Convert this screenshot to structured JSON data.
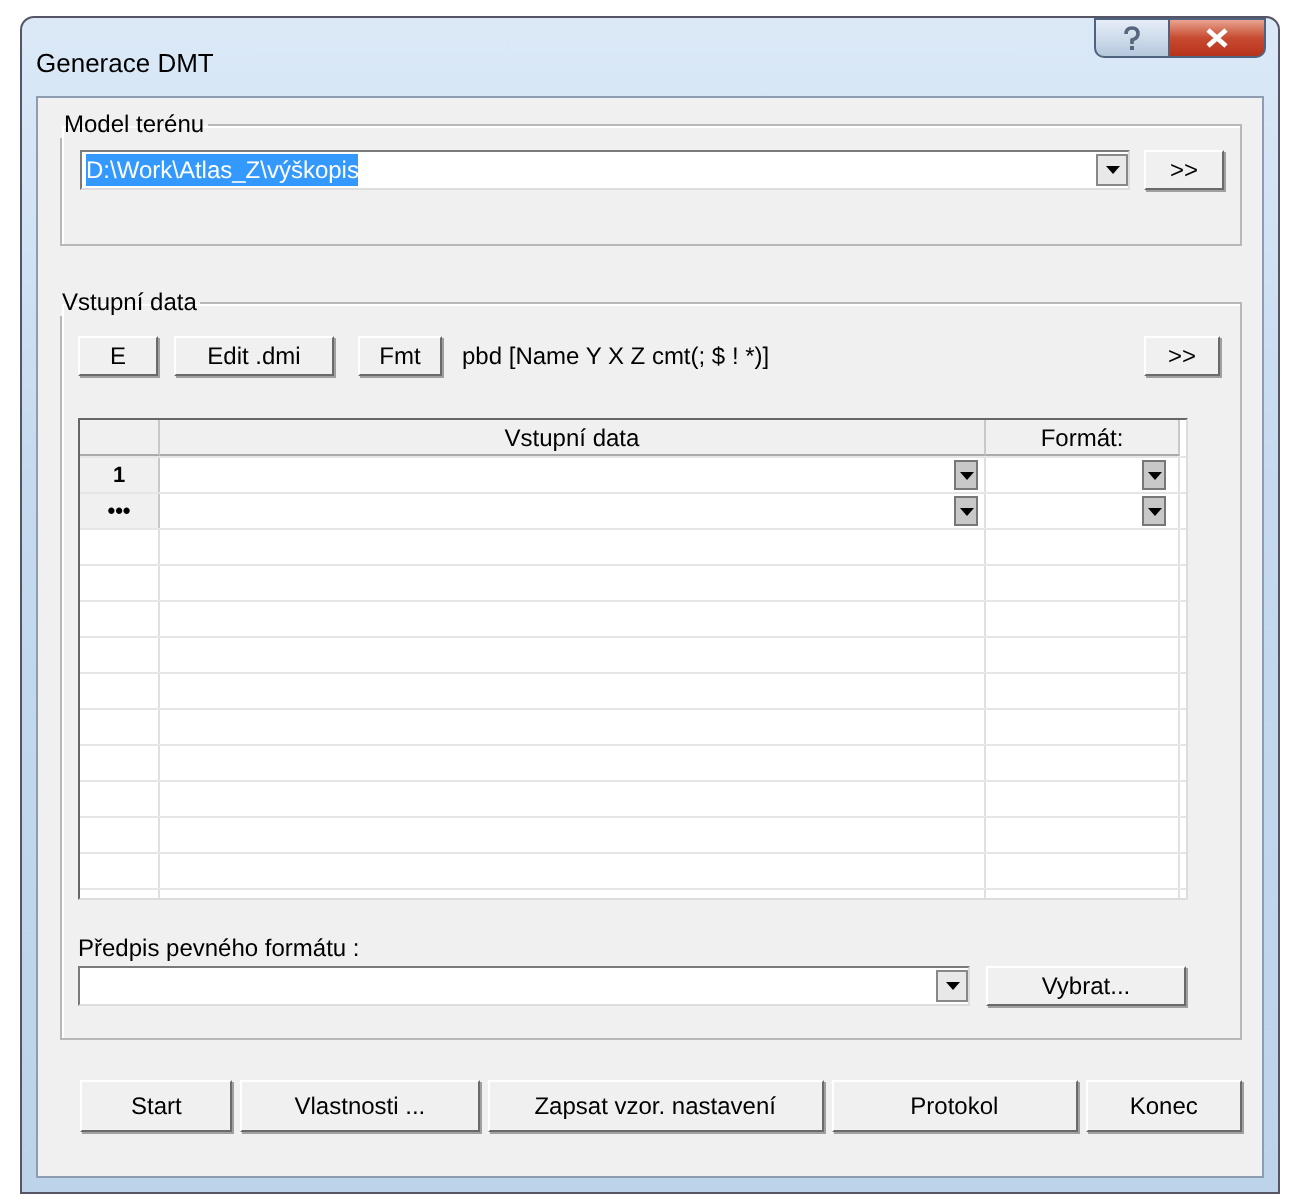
{
  "window": {
    "title": "Generace DMT"
  },
  "model_group": {
    "title": "Model terénu",
    "combo": {
      "value": "D:\\Work\\Atlas_Z\\výškopis",
      "text_selected": true
    },
    "browse_button": ">>"
  },
  "input_group": {
    "title": "Vstupní data",
    "toolbar": {
      "buttons": [
        "E",
        "Edit .dmi",
        "Fmt"
      ],
      "format_text": "pbd [Name Y X Z cmt(; $ ! *)]",
      "more_button": ">>"
    },
    "grid": {
      "columns": [
        "Vstupní data",
        "Formát:"
      ],
      "rows": [
        {
          "header": "1"
        },
        {
          "header": "•••"
        }
      ]
    },
    "fixed_format": {
      "label": "Předpis pevného formátu :",
      "select_button": "Vybrat..."
    }
  },
  "buttons": [
    "Start",
    "Vlastnosti ...",
    "Zapsat vzor. nastavení",
    "Protokol",
    "Konec"
  ]
}
